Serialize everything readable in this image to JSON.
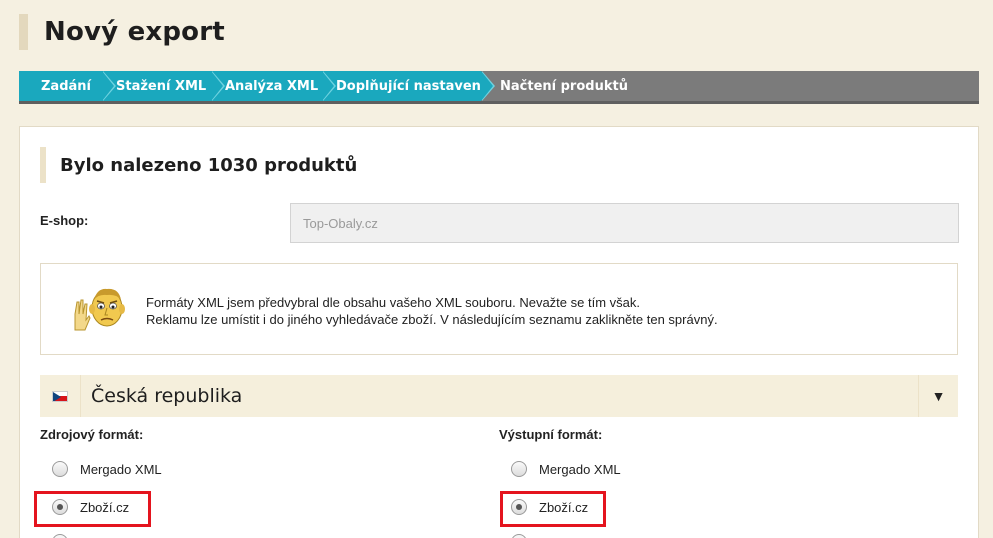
{
  "page": {
    "title": "Nový export"
  },
  "steps": [
    {
      "label": "Zadání",
      "state": "done"
    },
    {
      "label": "Stažení XML",
      "state": "done"
    },
    {
      "label": "Analýza XML",
      "state": "done"
    },
    {
      "label": "Doplňující nastavení",
      "state": "done"
    },
    {
      "label": "Načtení produktů",
      "state": "current"
    }
  ],
  "panel": {
    "heading": "Bylo nalezeno 1030 produktů",
    "eshop_label": "E-shop:",
    "eshop_value": "Top-Obaly.cz",
    "info_line1": "Formáty XML jsem předvybral dle obsahu vašeho XML souboru. Nevažte se tím však.",
    "info_line2": "Reklamu lze umístit i do jiného vyhledávače zboží. V následujícím seznamu zaklikněte ten správný.",
    "country": "Česká republika",
    "toggle_icon": "▼",
    "source": {
      "title": "Zdrojový formát:",
      "options": [
        {
          "label": "Mergado XML",
          "checked": false
        },
        {
          "label": "Zboží.cz",
          "checked": true
        }
      ]
    },
    "output": {
      "title": "Výstupní formát:",
      "options": [
        {
          "label": "Mergado XML",
          "checked": false
        },
        {
          "label": "Zboží.cz",
          "checked": true
        }
      ]
    }
  },
  "colors": {
    "step_done": "#1aa8be",
    "step_pending": "#7b7b7b",
    "highlight": "#e4141e",
    "page_bg": "#f5f0e1"
  }
}
